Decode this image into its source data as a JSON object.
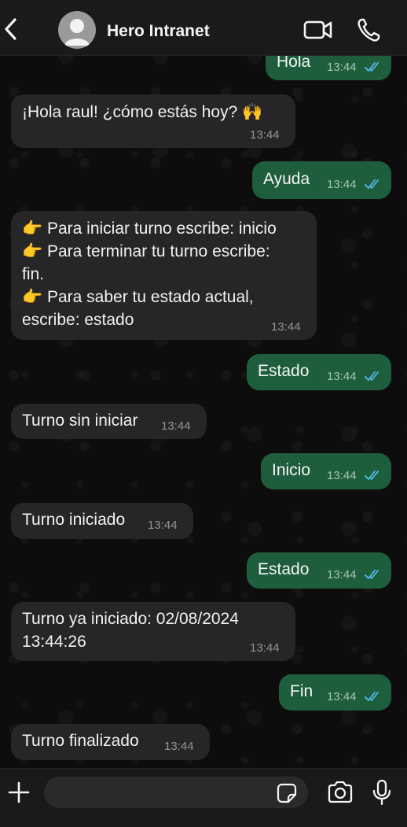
{
  "header": {
    "contact_name": "Hero Intranet"
  },
  "messages": [
    {
      "direction": "out",
      "text": "Hola",
      "time": "13:44"
    },
    {
      "direction": "in",
      "text": "¡Hola raul!  ¿cómo estás hoy? 🙌",
      "time": "13:44"
    },
    {
      "direction": "out",
      "text": "Ayuda",
      "time": "13:44"
    },
    {
      "direction": "in",
      "lines": [
        "👉 Para iniciar turno escribe: inicio",
        "👉 Para terminar tu turno escribe:",
        "fin.",
        "👉 Para saber tu estado actual,",
        "escribe: estado"
      ],
      "time": "13:44"
    },
    {
      "direction": "out",
      "text": "Estado",
      "time": "13:44"
    },
    {
      "direction": "in",
      "text": "Turno sin iniciar",
      "time": "13:44"
    },
    {
      "direction": "out",
      "text": "Inicio",
      "time": "13:44"
    },
    {
      "direction": "in",
      "text": "Turno iniciado",
      "time": "13:44"
    },
    {
      "direction": "out",
      "text": "Estado",
      "time": "13:44"
    },
    {
      "direction": "in",
      "lines": [
        "Turno ya iniciado: 02/08/2024",
        "13:44:26"
      ],
      "time": "13:44"
    },
    {
      "direction": "out",
      "text": "Fin",
      "time": "13:44"
    },
    {
      "direction": "in",
      "text": "Turno finalizado",
      "time": "13:44"
    }
  ],
  "input": {
    "value": "",
    "placeholder": ""
  },
  "colors": {
    "outgoing_bubble": "#1e5e3c",
    "incoming_bubble": "#262628",
    "read_ticks": "#53bdeb",
    "header_bg": "#1a1a1a"
  },
  "icons": {
    "back": "chevron-left-icon",
    "avatar": "default-avatar-icon",
    "video": "video-camera-icon",
    "call": "phone-icon",
    "plus": "plus-icon",
    "sticker": "sticker-icon",
    "camera": "camera-icon",
    "mic": "microphone-icon",
    "read": "double-check-icon"
  }
}
